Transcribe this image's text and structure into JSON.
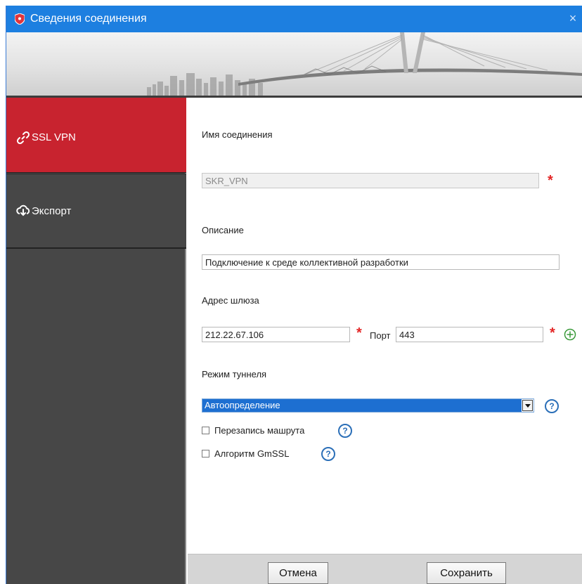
{
  "window": {
    "title": "Сведения соединения",
    "close_glyph": "×",
    "accent_color": "#1d7fe0",
    "icon": "shield-icon"
  },
  "sidebar": {
    "items": [
      {
        "label": "SSL VPN",
        "icon": "link-icon",
        "active": true,
        "color": "#c8232f"
      },
      {
        "label": "Экспорт",
        "icon": "cloud-download-icon",
        "active": false
      }
    ]
  },
  "form": {
    "connection_name": {
      "label": "Имя соединения",
      "value": "SKR_VPN",
      "disabled": true,
      "required": true
    },
    "description": {
      "label": "Описание",
      "value": "Подключение к среде коллективной разработки"
    },
    "gateway": {
      "label": "Адрес шлюза",
      "value": "212.22.67.106",
      "required": true
    },
    "port": {
      "label": "Порт",
      "value": "443",
      "required": true
    },
    "tunnel_mode": {
      "label": "Режим туннеля",
      "value": "Автоопределение"
    },
    "route_overwrite": {
      "label": "Перезапись машрута",
      "checked": false
    },
    "gmssl": {
      "label": "Алгоритм GmSSL",
      "checked": false
    },
    "required_mark": "*",
    "help_glyph": "?"
  },
  "footer": {
    "cancel_label": "Отмена",
    "save_label": "Сохранить"
  }
}
